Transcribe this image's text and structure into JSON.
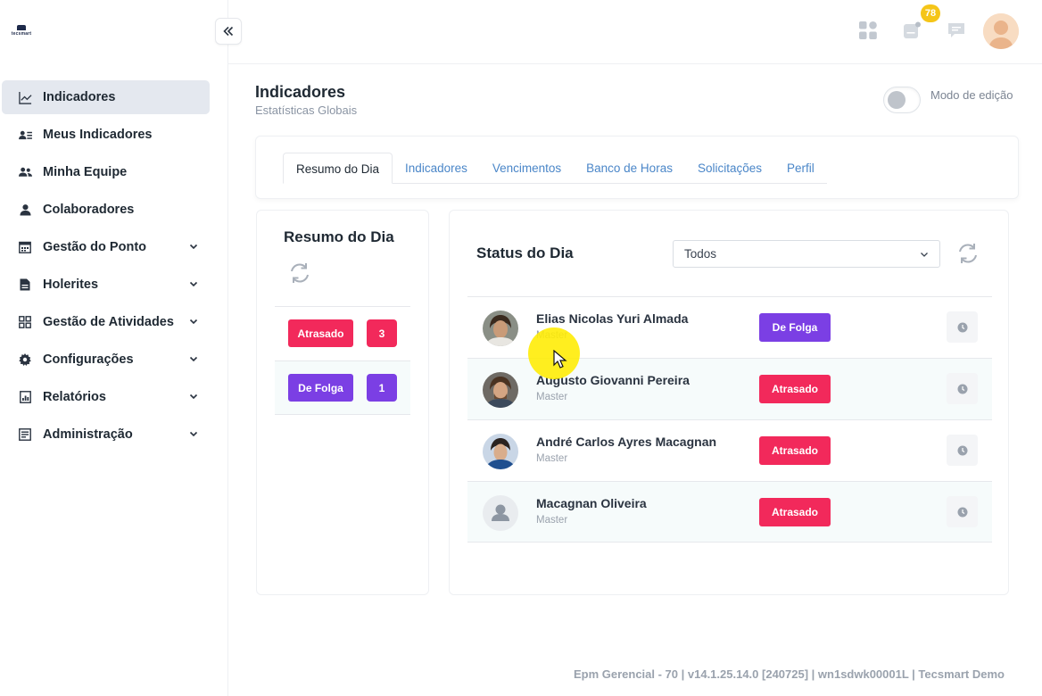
{
  "brand": {
    "logo_text": "tecsmart"
  },
  "sidebar": {
    "items": [
      {
        "label": "Indicadores",
        "icon": "chart-line-icon",
        "active": true,
        "expandable": false
      },
      {
        "label": "Meus Indicadores",
        "icon": "id-card-icon",
        "active": false,
        "expandable": false
      },
      {
        "label": "Minha Equipe",
        "icon": "users-icon",
        "active": false,
        "expandable": false
      },
      {
        "label": "Colaboradores",
        "icon": "user-icon",
        "active": false,
        "expandable": false
      },
      {
        "label": "Gestão do Ponto",
        "icon": "calendar-icon",
        "active": false,
        "expandable": true
      },
      {
        "label": "Holerites",
        "icon": "document-icon",
        "active": false,
        "expandable": true
      },
      {
        "label": "Gestão de Atividades",
        "icon": "grid-icon",
        "active": false,
        "expandable": true
      },
      {
        "label": "Configurações",
        "icon": "gear-icon",
        "active": false,
        "expandable": true
      },
      {
        "label": "Relatórios",
        "icon": "report-icon",
        "active": false,
        "expandable": true
      },
      {
        "label": "Administração",
        "icon": "admin-icon",
        "active": false,
        "expandable": true
      }
    ]
  },
  "topbar": {
    "notifications_count": "78"
  },
  "page": {
    "title": "Indicadores",
    "subtitle": "Estatísticas Globais",
    "edit_mode_label": "Modo de edição",
    "edit_mode_on": false
  },
  "tabs": [
    {
      "label": "Resumo do Dia",
      "active": true
    },
    {
      "label": "Indicadores",
      "active": false
    },
    {
      "label": "Vencimentos",
      "active": false
    },
    {
      "label": "Banco de Horas",
      "active": false
    },
    {
      "label": "Solicitações",
      "active": false
    },
    {
      "label": "Perfil",
      "active": false
    }
  ],
  "resumo": {
    "title": "Resumo do Dia",
    "rows": [
      {
        "label": "Atrasado",
        "count": "3",
        "color": "#f2295b"
      },
      {
        "label": "De Folga",
        "count": "1",
        "color": "#7b3fe4"
      }
    ]
  },
  "status": {
    "title": "Status do Dia",
    "filter_value": "Todos",
    "people": [
      {
        "name": "Elias Nicolas Yuri Almada",
        "role": "Master",
        "status": "De Folga",
        "status_color": "#7b3fe4",
        "avatar": "photo"
      },
      {
        "name": "Augusto Giovanni Pereira",
        "role": "Master",
        "status": "Atrasado",
        "status_color": "#f2295b",
        "avatar": "photo"
      },
      {
        "name": "André Carlos Ayres Macagnan",
        "role": "Master",
        "status": "Atrasado",
        "status_color": "#f2295b",
        "avatar": "photo"
      },
      {
        "name": "Macagnan Oliveira",
        "role": "Master",
        "status": "Atrasado",
        "status_color": "#f2295b",
        "avatar": "placeholder"
      }
    ]
  },
  "footer": {
    "text": "Epm Gerencial - 70 | v14.1.25.14.0 [240725] | wn1sdwk00001L | Tecsmart Demo"
  },
  "colors": {
    "accent_blue": "#4a86c8",
    "late_red": "#f2295b",
    "dayoff_purple": "#7b3fe4",
    "badge_yellow": "#f5c518"
  }
}
